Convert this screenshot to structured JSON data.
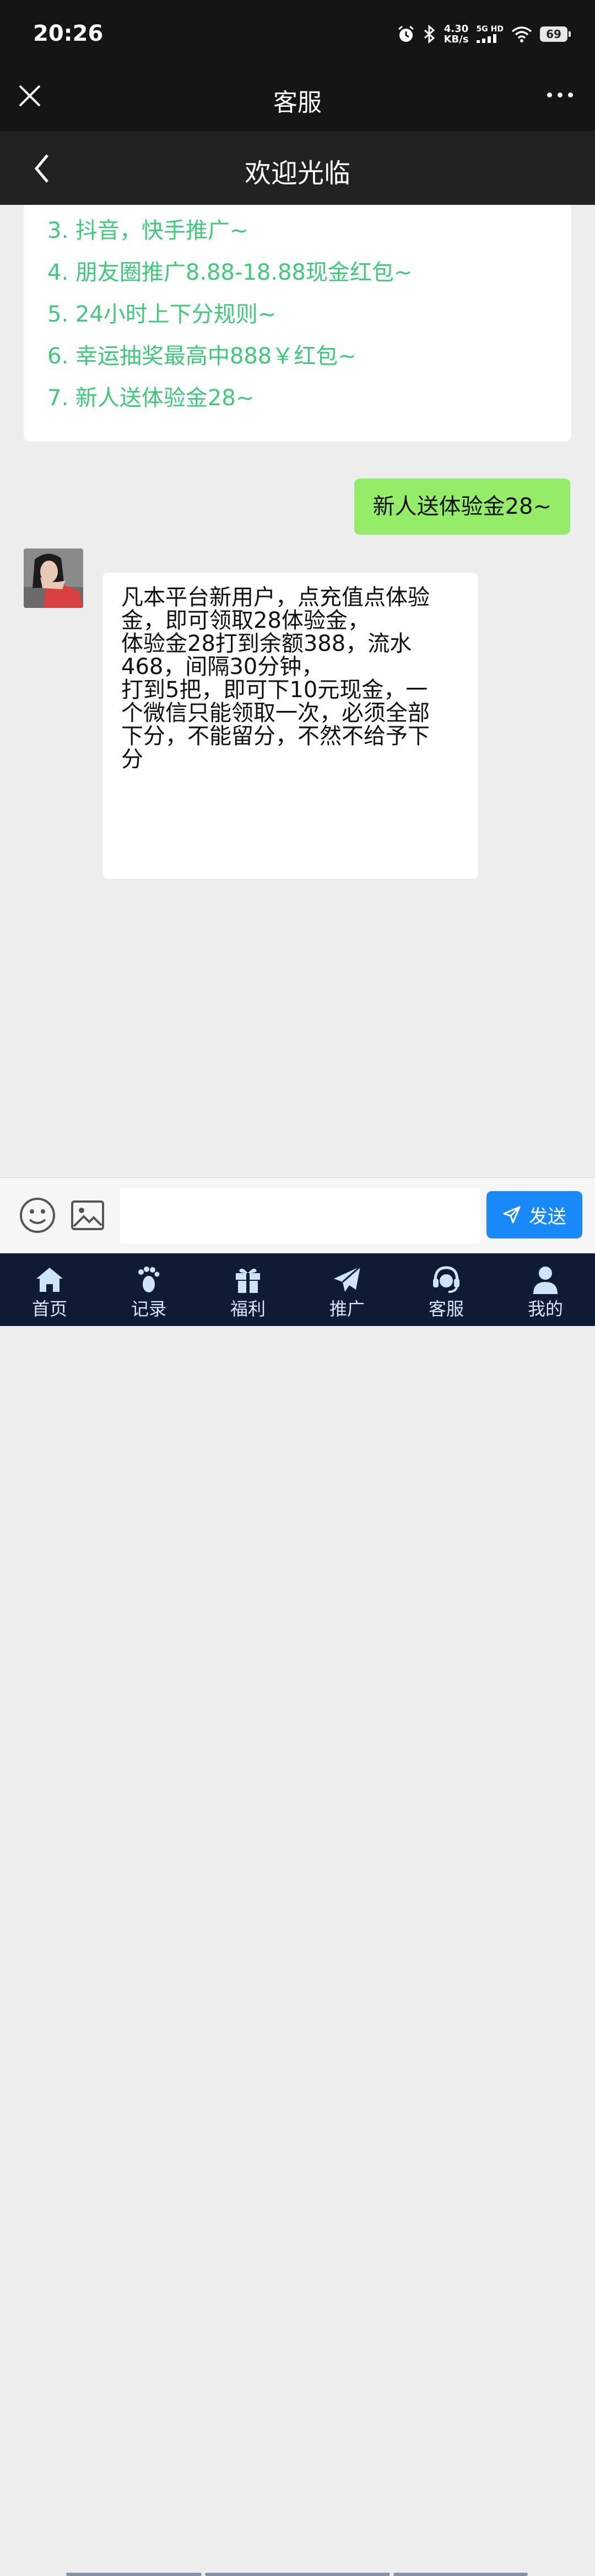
{
  "status_bar": {
    "time": "20:26",
    "speed_value": "4.30",
    "speed_unit": "KB/s",
    "network": "5G HD",
    "battery": "69",
    "icons": [
      "alarm-icon",
      "bluetooth-icon",
      "signal-icon",
      "wifi-icon",
      "battery-icon"
    ]
  },
  "wx_header": {
    "title": "客服"
  },
  "page_header": {
    "title": "欢迎光临"
  },
  "menu_items": [
    "3. 抖音，快手推广~",
    "4. 朋友圈推广8.88-18.88现金红包~",
    "5. 24小时上下分规则~",
    "6. 幸运抽奖最高中888￥红包~",
    "7. 新人送体验金28~"
  ],
  "messages": {
    "user_message": "新人送体验金28~",
    "agent_reply_lines": [
      "凡本平台新用户，点充值点体验",
      "金，即可领取28体验金，",
      "体验金28打到余额388，流水",
      "468，间隔30分钟，",
      "打到5把，即可下10元现金，一",
      "个微信只能领取一次，必须全部",
      "下分，不能留分，不然不给予下",
      "分"
    ]
  },
  "input_bar": {
    "placeholder": "",
    "send_label": "发送"
  },
  "colors": {
    "menu_text": "#3fca7b",
    "user_bubble": "#95ec69",
    "send_button": "#1989fa",
    "tab_bar": "#0f1b34"
  },
  "tabs": [
    {
      "label": "首页",
      "icon": "home-icon"
    },
    {
      "label": "记录",
      "icon": "footprint-icon"
    },
    {
      "label": "福利",
      "icon": "gift-icon"
    },
    {
      "label": "推广",
      "icon": "paper-plane-icon"
    },
    {
      "label": "客服",
      "icon": "headset-icon"
    },
    {
      "label": "我的",
      "icon": "user-icon"
    }
  ]
}
